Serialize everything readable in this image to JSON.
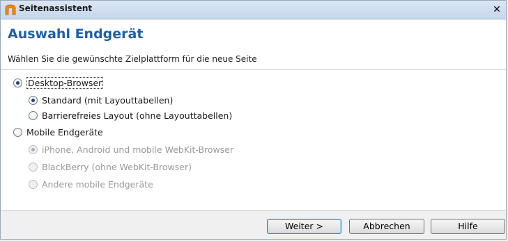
{
  "window": {
    "title": "Seitenassistent",
    "close_glyph": "✕",
    "icon": "app-icon"
  },
  "header": {
    "title": "Auswahl Endgerät",
    "subtitle": "Wählen Sie die gewünschte Zielplattform für die neue Seite"
  },
  "options": {
    "desktop": {
      "label": "Desktop-Browser",
      "checked": true,
      "disabled": false
    },
    "standard": {
      "label": "Standard (mit Layouttabellen)",
      "checked": true,
      "disabled": false
    },
    "barrierefrei": {
      "label": "Barrierefreies Layout (ohne Layouttabellen)",
      "checked": false,
      "disabled": false
    },
    "mobile": {
      "label": "Mobile Endgeräte",
      "checked": false,
      "disabled": false
    },
    "iphone": {
      "label": "iPhone, Android und mobile WebKit-Browser",
      "checked": true,
      "disabled": true
    },
    "blackberry": {
      "label": "BlackBerry (ohne WebKit-Browser)",
      "checked": false,
      "disabled": true
    },
    "andere": {
      "label": "Andere mobile Endgeräte",
      "checked": false,
      "disabled": true
    }
  },
  "buttons": {
    "next": "Weiter >",
    "cancel": "Abbrechen",
    "help": "Hilfe"
  },
  "colors": {
    "title_accent": "#1f5fa8",
    "default_button_border": "#3c7fb1"
  }
}
